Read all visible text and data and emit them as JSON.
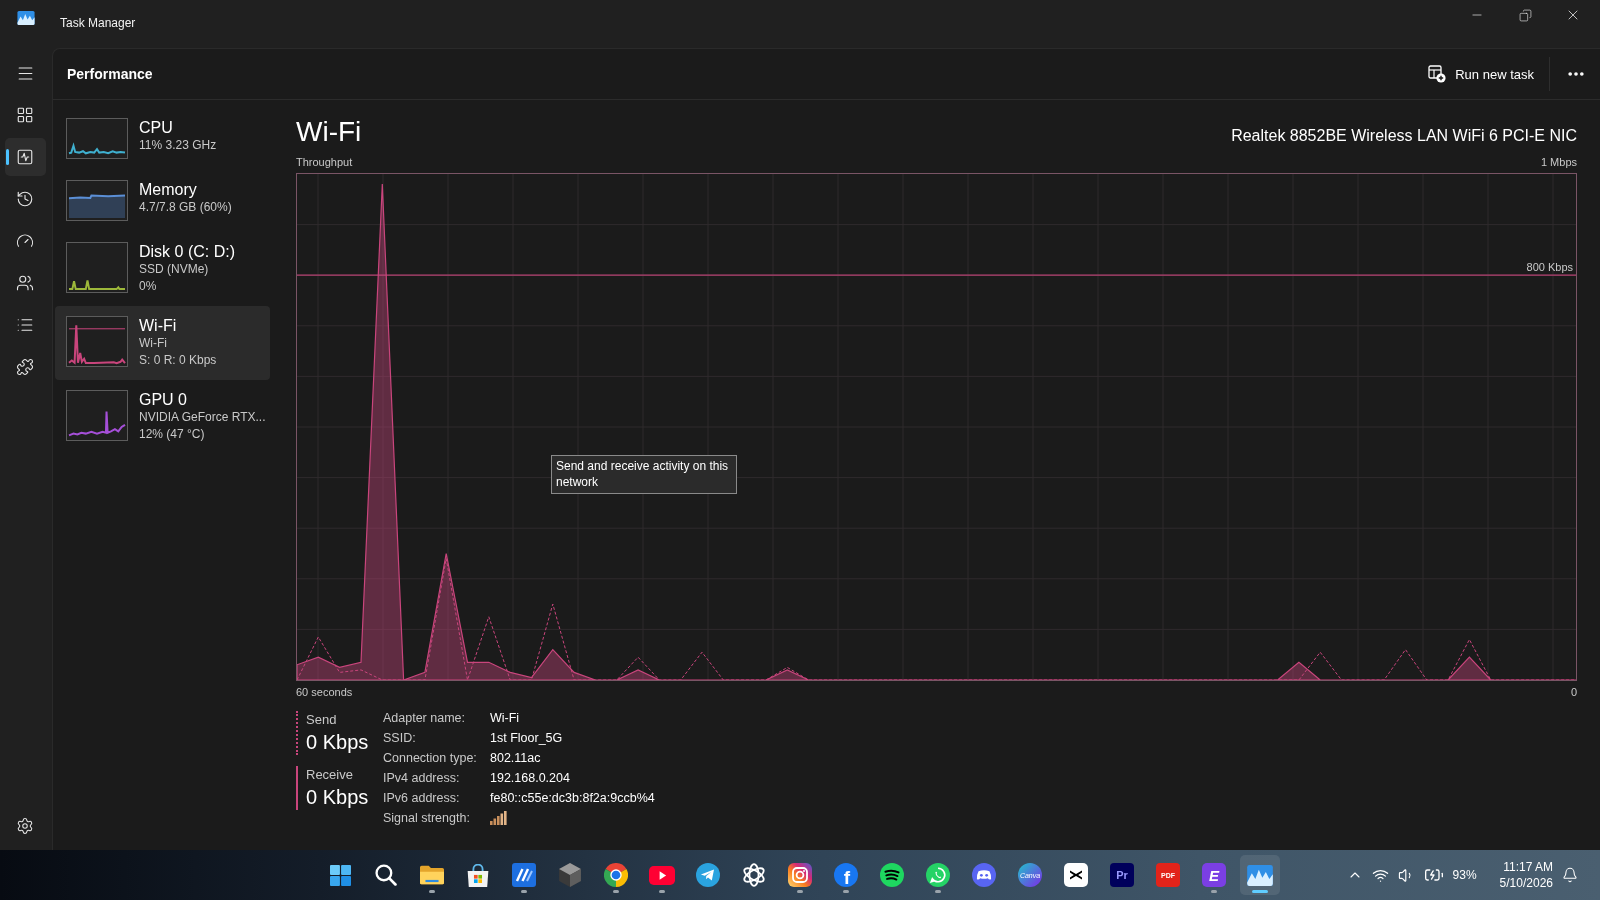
{
  "window": {
    "title": "Task Manager"
  },
  "nav": {
    "items": [
      {
        "kind": "processes",
        "selected": false
      },
      {
        "kind": "performance",
        "selected": true
      },
      {
        "kind": "app_history",
        "selected": false
      },
      {
        "kind": "startup",
        "selected": false
      },
      {
        "kind": "users",
        "selected": false
      },
      {
        "kind": "details",
        "selected": false
      },
      {
        "kind": "services",
        "selected": false
      }
    ]
  },
  "header": {
    "title": "Performance",
    "action": "Run new task"
  },
  "resources": [
    {
      "kind": "cpu",
      "name": "CPU",
      "lines": [
        "11% 3.23 GHz"
      ],
      "color": "#3fb0cf",
      "selected": false
    },
    {
      "kind": "memory",
      "name": "Memory",
      "lines": [
        "4.7/7.8 GB (60%)"
      ],
      "color": "#5b8fd6",
      "selected": false
    },
    {
      "kind": "disk",
      "name": "Disk 0 (C: D:)",
      "lines": [
        "SSD (NVMe)",
        "0%"
      ],
      "color": "#9db83a",
      "selected": false
    },
    {
      "kind": "network",
      "name": "Wi-Fi",
      "lines": [
        "Wi-Fi",
        "S: 0 R: 0 Kbps"
      ],
      "color": "#c9457c",
      "selected": true
    },
    {
      "kind": "gpu",
      "name": "GPU 0",
      "lines": [
        "NVIDIA GeForce RTX...",
        "12% (47 °C)"
      ],
      "color": "#a54fd8",
      "selected": false
    }
  ],
  "detail": {
    "title": "Wi-Fi",
    "adapter": "Realtek 8852BE Wireless LAN WiFi 6 PCI-E NIC",
    "graph": {
      "label": "Throughput",
      "max_label": "1 Mbps",
      "scale_label": "800 Kbps",
      "start_label": "60 seconds",
      "end_label": "0"
    },
    "tooltip": "Send and receive activity on this network",
    "rates": [
      {
        "kind": "send",
        "label": "Send",
        "value": "0 Kbps"
      },
      {
        "kind": "receive",
        "label": "Receive",
        "value": "0 Kbps"
      }
    ],
    "properties": [
      {
        "kind": "text",
        "label": "Adapter name:",
        "value": "Wi-Fi"
      },
      {
        "kind": "text",
        "label": "SSID:",
        "value": "1st Floor_5G"
      },
      {
        "kind": "text",
        "label": "Connection type:",
        "value": "802.11ac"
      },
      {
        "kind": "text",
        "label": "IPv4 address:",
        "value": "192.168.0.204"
      },
      {
        "kind": "text",
        "label": "IPv6 address:",
        "value": "fe80::c55e:dc3b:8f2a:9ccb%4"
      },
      {
        "kind": "signal",
        "label": "Signal strength:"
      }
    ]
  },
  "taskbar": {
    "apps": [
      {
        "kind": "start",
        "running": false,
        "selected": false
      },
      {
        "kind": "search",
        "running": false,
        "selected": false
      },
      {
        "kind": "folder",
        "running": true,
        "selected": false
      },
      {
        "kind": "store",
        "running": false,
        "selected": false
      },
      {
        "kind": "slash_tile",
        "running": true,
        "selected": false
      },
      {
        "kind": "cube",
        "running": false,
        "selected": false
      },
      {
        "kind": "browser",
        "running": true,
        "selected": false
      },
      {
        "kind": "video",
        "running": true,
        "selected": false
      },
      {
        "kind": "plane",
        "running": false,
        "selected": false
      },
      {
        "kind": "knot",
        "running": false,
        "selected": false
      },
      {
        "kind": "camera",
        "running": true,
        "selected": false
      },
      {
        "kind": "letter_circle",
        "glyph": "f",
        "running": true,
        "selected": false
      },
      {
        "kind": "music",
        "running": false,
        "selected": false
      },
      {
        "kind": "chat",
        "running": true,
        "selected": false
      },
      {
        "kind": "gamepad",
        "running": false,
        "selected": false
      },
      {
        "kind": "script_circle",
        "glyph": "Canva",
        "running": false,
        "selected": false
      },
      {
        "kind": "bowtie",
        "running": false,
        "selected": false
      },
      {
        "kind": "letter_square_dark",
        "glyph": "Pr",
        "running": false,
        "selected": false
      },
      {
        "kind": "letter_square_red",
        "glyph": "PDF",
        "running": false,
        "selected": false
      },
      {
        "kind": "letter_square_violet",
        "glyph": "E",
        "running": true,
        "selected": false
      },
      {
        "kind": "monitor",
        "running": false,
        "selected": true
      }
    ],
    "tray": {
      "battery": "93%",
      "time": "11:17 AM",
      "date": "5/10/2026"
    }
  }
}
